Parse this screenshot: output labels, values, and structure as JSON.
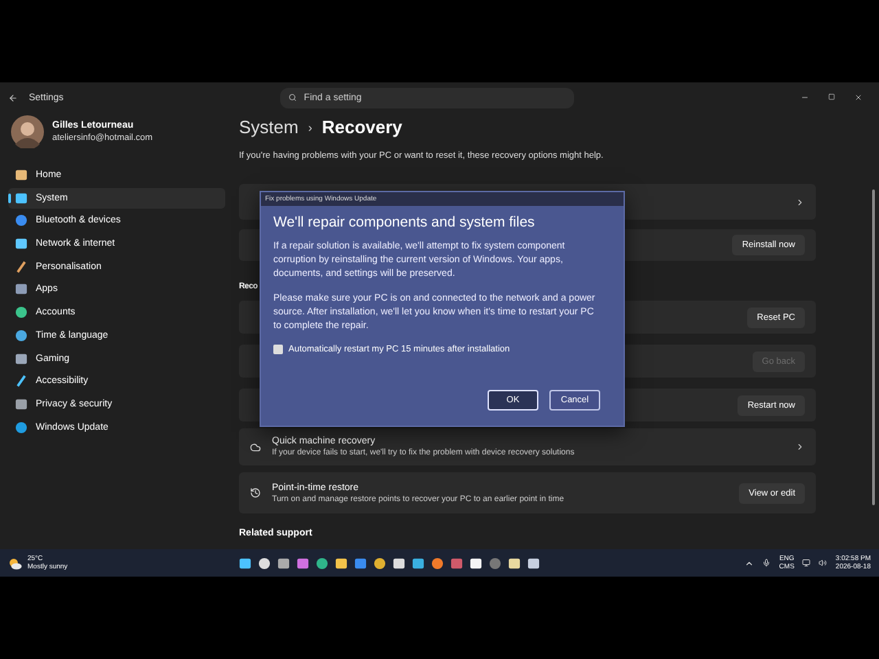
{
  "window": {
    "title": "Settings"
  },
  "search": {
    "placeholder": "Find a setting"
  },
  "user": {
    "name": "Gilles Letourneau",
    "email": "ateliersinfo@hotmail.com"
  },
  "nav": [
    {
      "label": "Home",
      "selected": false
    },
    {
      "label": "System",
      "selected": true
    },
    {
      "label": "Bluetooth & devices",
      "selected": false
    },
    {
      "label": "Network & internet",
      "selected": false
    },
    {
      "label": "Personalisation",
      "selected": false
    },
    {
      "label": "Apps",
      "selected": false
    },
    {
      "label": "Accounts",
      "selected": false
    },
    {
      "label": "Time & language",
      "selected": false
    },
    {
      "label": "Gaming",
      "selected": false
    },
    {
      "label": "Accessibility",
      "selected": false
    },
    {
      "label": "Privacy & security",
      "selected": false
    },
    {
      "label": "Windows Update",
      "selected": false
    }
  ],
  "breadcrumb": {
    "parent": "System",
    "separator": "›",
    "current": "Recovery"
  },
  "description": "If you're having problems with your PC or want to reset it, these recovery options might help.",
  "cards": [
    {
      "kind": "link"
    },
    {
      "kind": "action",
      "button": "Reinstall now",
      "disabled": false
    },
    {
      "kind": "heading",
      "text": "Reco"
    },
    {
      "kind": "action",
      "button": "Reset PC",
      "disabled": false
    },
    {
      "kind": "action",
      "button": "Go back",
      "disabled": true
    },
    {
      "kind": "action",
      "button": "Restart now",
      "disabled": false
    },
    {
      "kind": "link",
      "title": "Quick machine recovery",
      "subtitle": "If your device fails to start, we'll try to fix the problem with device recovery solutions"
    },
    {
      "kind": "action",
      "title": "Point-in-time restore",
      "subtitle": "Turn on and manage restore points to recover your PC to an earlier point in time",
      "button": "View or edit",
      "disabled": false
    },
    {
      "kind": "heading",
      "text": "Related support"
    }
  ],
  "dialog": {
    "caption": "Fix problems using Windows Update",
    "heading": "We'll repair components and system files",
    "paragraphs": [
      "If a repair solution is available, we'll attempt to fix system component corruption by reinstalling the current version of Windows. Your apps, documents, and settings will be preserved.",
      "Please make sure your PC is on and connected to the network and a power source. After installation, we'll let you know when it's time to restart your PC to complete the repair."
    ],
    "checkbox": {
      "label": "Automatically restart my PC 15 minutes after installation",
      "checked": false
    },
    "buttons": [
      {
        "label": "OK",
        "primary": true
      },
      {
        "label": "Cancel",
        "primary": false
      }
    ]
  },
  "taskbar": {
    "weather": {
      "temperature": "25°C",
      "condition": "Mostly sunny"
    },
    "language": "ENG",
    "layout": "CMS",
    "time": "3:02:58 PM",
    "date": "2026-08-18"
  }
}
